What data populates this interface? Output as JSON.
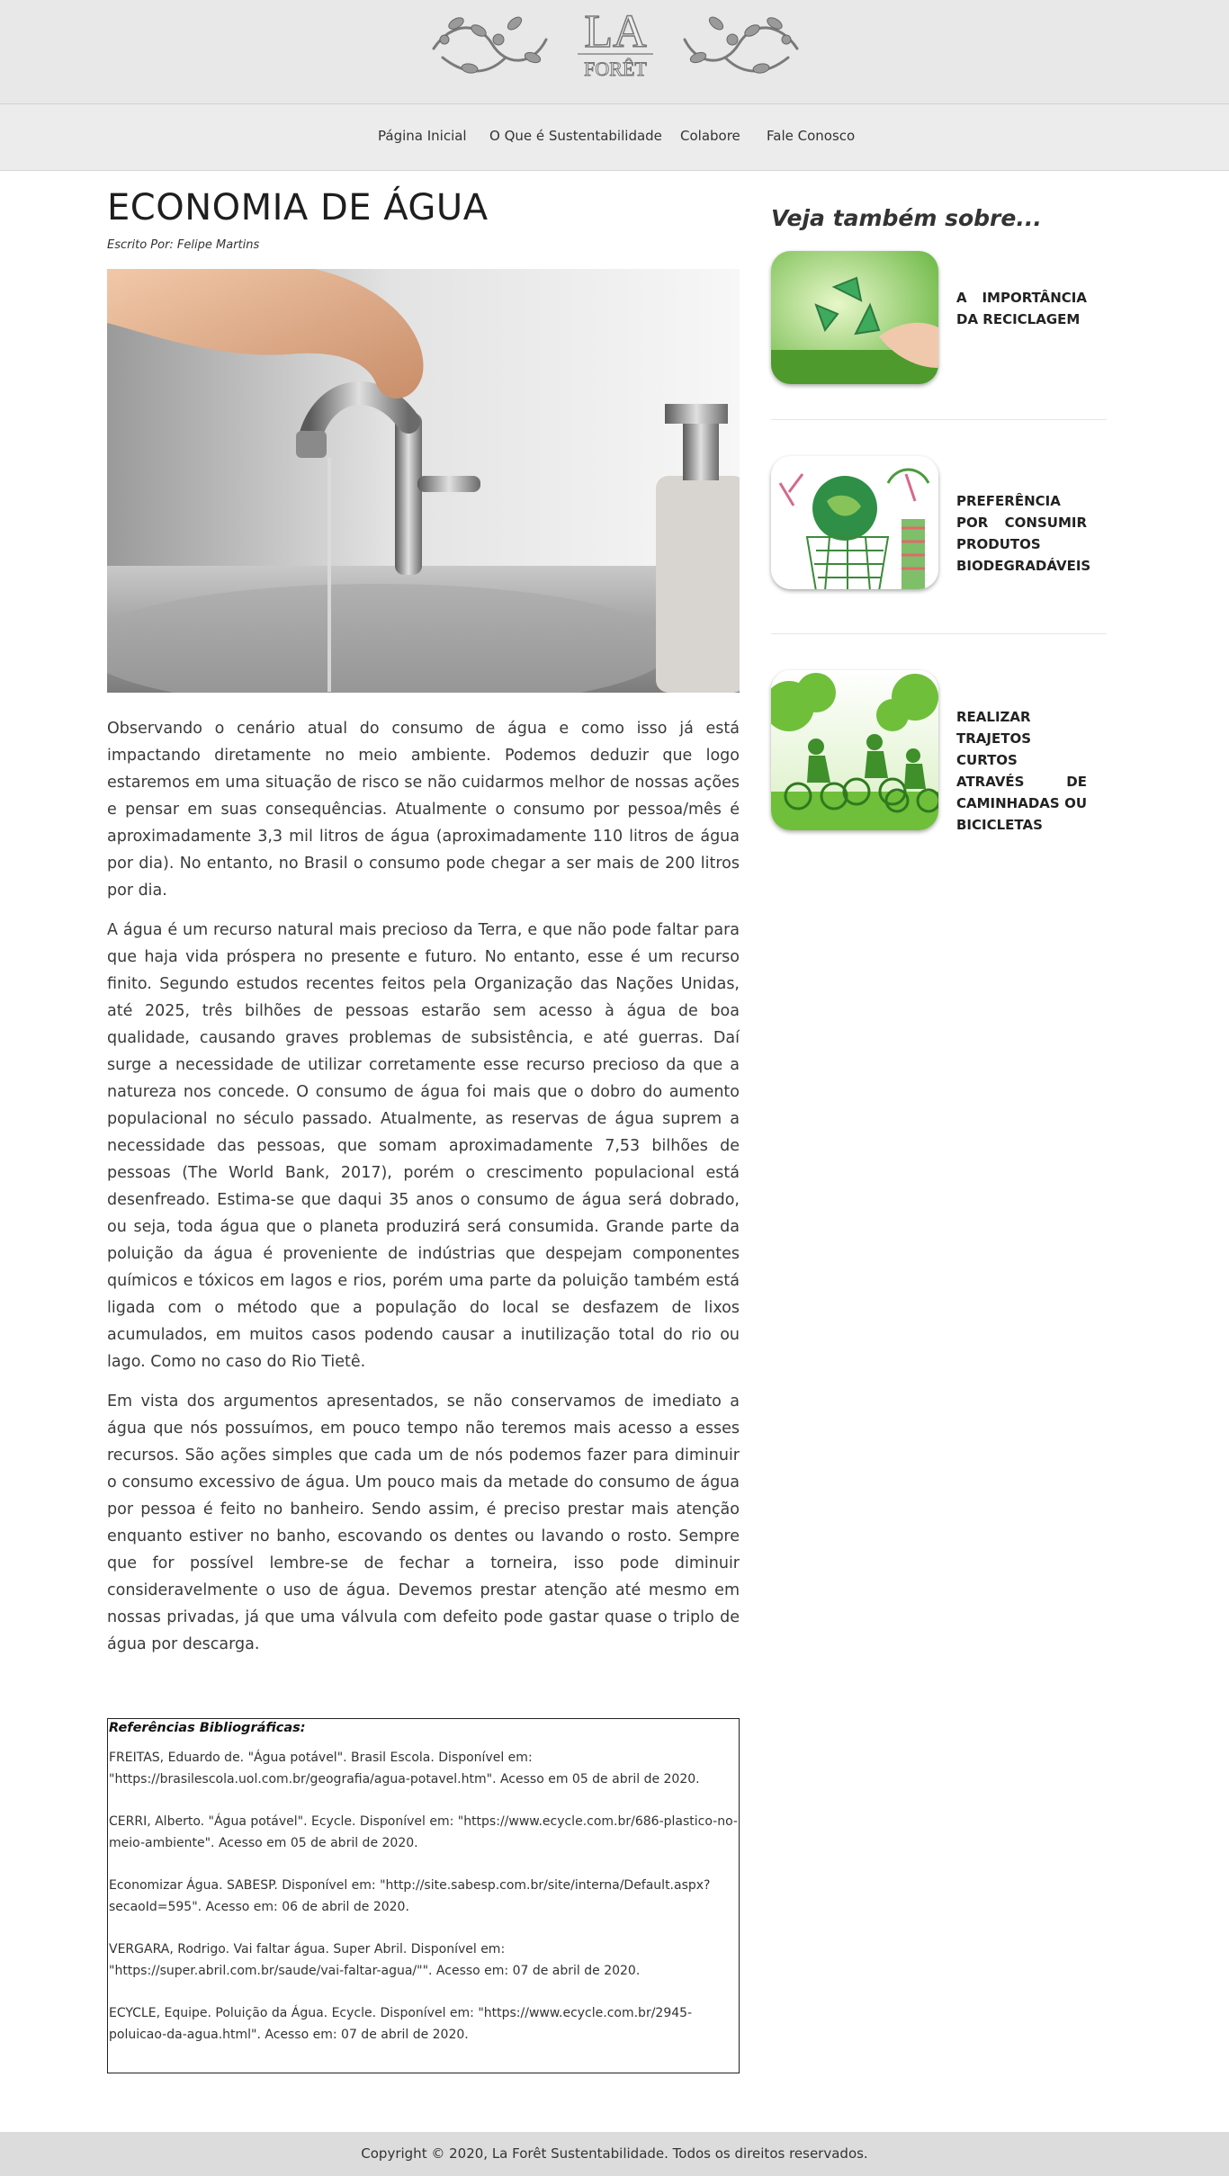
{
  "header": {
    "logo_text_top": "LA",
    "logo_text_bottom": "FORÊT"
  },
  "nav": {
    "items": [
      "Página Inicial",
      "O Que é Sustentabilidade",
      "Colabore",
      "Fale Conosco"
    ]
  },
  "article": {
    "title": "ECONOMIA DE ÁGUA",
    "author": "Escrito Por: Felipe Martins",
    "paragraphs": [
      "Observando o cenário atual do consumo de água e como isso já está impactando diretamente no meio ambiente. Podemos deduzir que logo estaremos em uma situação de risco se não cuidarmos melhor de nossas ações e pensar em suas consequências. Atualmente o consumo por pessoa/mês é aproximadamente 3,3 mil litros de água (aproximadamente 110 litros de água por dia). No entanto, no Brasil o consumo pode chegar a ser mais de 200 litros por dia.",
      "A água é um recurso natural mais precioso da Terra, e que não pode faltar para que haja vida próspera no presente e futuro. No entanto, esse é um recurso finito. Segundo estudos recentes feitos pela Organização das Nações Unidas, até 2025, três bilhões de pessoas estarão sem acesso à água de boa qualidade, causando graves problemas de subsistência, e até guerras. Daí surge a necessidade de utilizar corretamente esse recurso precioso da que a natureza nos concede. O consumo de água foi mais que o dobro do aumento populacional no século passado. Atualmente, as reservas de água suprem a necessidade das pessoas, que somam aproximadamente 7,53 bilhões de pessoas (The World Bank, 2017), porém o crescimento populacional está desenfreado. Estima-se que daqui 35 anos o consumo de água será dobrado, ou seja, toda água que o planeta produzirá será consumida. Grande parte da poluição da água é proveniente de indústrias que despejam componentes químicos e tóxicos em lagos e rios, porém uma parte da poluição também está ligada com o método que a população do local se desfazem de lixos acumulados, em muitos casos podendo causar a inutilização total do rio ou lago. Como no caso do Rio Tietê.",
      "Em vista dos argumentos apresentados, se não conservamos de imediato a água que nós possuímos, em pouco tempo não teremos mais acesso a esses recursos. São ações simples que cada um de nós podemos fazer para diminuir o consumo excessivo de água. Um pouco mais da metade do consumo de água por pessoa é feito no banheiro. Sendo assim, é preciso prestar mais atenção enquanto estiver no banho, escovando os dentes ou lavando o rosto. Sempre que for possível lembre-se de fechar a torneira, isso pode diminuir consideravelmente o uso de água. Devemos prestar atenção até mesmo em nossas privadas, já que uma válvula com defeito pode gastar quase o triplo de água por descarga."
    ]
  },
  "references": {
    "title": "Referências Bibliográficas:",
    "items": [
      "FREITAS, Eduardo de. \"Água potável\". Brasil Escola. Disponível em: \"https://brasilescola.uol.com.br/geografia/agua-potavel.htm\". Acesso em 05 de abril de 2020.",
      "CERRI, Alberto. \"Água potável\". Ecycle. Disponível em: \"https://www.ecycle.com.br/686-plastico-no-meio-ambiente\". Acesso em 05 de abril de 2020.",
      "Economizar Água. SABESP. Disponível em: \"http://site.sabesp.com.br/site/interna/Default.aspx?secaoId=595\". Acesso em: 06 de abril de 2020.",
      "VERGARA, Rodrigo. Vai faltar água. Super Abril. Disponível em: \"https://super.abril.com.br/saude/vai-faltar-agua/\"\". Acesso em: 07 de abril de 2020.",
      "ECYCLE, Equipe. Poluição da Água. Ecycle. Disponível em: \"https://www.ecycle.com.br/2945-poluicao-da-agua.html\". Acesso em: 07 de abril de 2020."
    ]
  },
  "sidebar": {
    "heading": "Veja também sobre...",
    "cards": [
      {
        "title": "A IMPORTÂNCIA DA RECICLAGEM",
        "icon": "recycle-hand-image"
      },
      {
        "title": "PREFERÊNCIA POR CONSUMIR PRODUTOS BIODEGRADÁVEIS",
        "icon": "eco-shopping-bag-image"
      },
      {
        "title": "REALIZAR TRAJETOS CURTOS ATRAVÉS DE CAMINHADAS OU BICICLETAS",
        "icon": "cyclists-image"
      }
    ]
  },
  "footer": {
    "text": "Copyright © 2020, La Forêt Sustentabilidade. Todos os direitos reservados."
  },
  "colors": {
    "header_bg": "#e8e8e8",
    "footer_bg": "#dcdcdc",
    "eco_green": "#6fbf3a"
  }
}
